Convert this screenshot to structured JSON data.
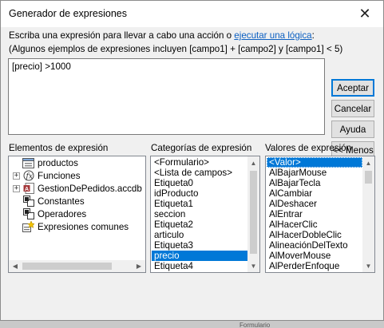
{
  "dialog": {
    "title": "Generador de expresiones",
    "close_label": "✕",
    "instruction_prefix": "Escriba una expresión para llevar a cabo una acción o ",
    "instruction_link": "ejecutar una lógica",
    "instruction_suffix": ":",
    "hint": "(Algunos ejemplos de expresiones incluyen [campo1] + [campo2] y [campo1] < 5)",
    "expression": "[precio] >1000"
  },
  "buttons": {
    "accept": "Aceptar",
    "cancel": "Cancelar",
    "help": "Ayuda",
    "less": "<< Menos"
  },
  "sections": {
    "elements": "Elementos de expresión",
    "categories": "Categorías de expresión",
    "values": "Valores de expresión"
  },
  "tree": [
    {
      "label": "productos",
      "icon": "form-icon",
      "expander": ""
    },
    {
      "label": "Funciones",
      "icon": "function-icon",
      "expander": "+"
    },
    {
      "label": "GestionDePedidos.accdb",
      "icon": "access-db-icon",
      "expander": "+"
    },
    {
      "label": "Constantes",
      "icon": "constants-icon",
      "expander": ""
    },
    {
      "label": "Operadores",
      "icon": "operators-icon",
      "expander": ""
    },
    {
      "label": "Expresiones comunes",
      "icon": "common-expr-icon",
      "expander": ""
    }
  ],
  "categories": [
    "<Formulario>",
    "<Lista de campos>",
    "Etiqueta0",
    "idProducto",
    "Etiqueta1",
    "seccion",
    "Etiqueta2",
    "articulo",
    "Etiqueta3",
    "precio",
    "Etiqueta4"
  ],
  "categories_selected": "precio",
  "values": [
    "<Valor>",
    "AlBajarMouse",
    "AlBajarTecla",
    "AlCambiar",
    "AlDeshacer",
    "AlEntrar",
    "AlHacerClic",
    "AlHacerDobleClic",
    "AlineaciónDelTexto",
    "AlMoverMouse",
    "AlPerderEnfoque"
  ],
  "values_selected": "<Valor>",
  "background": {
    "text": "Formulario"
  },
  "colors": {
    "selection": "#0078d7",
    "link": "#0b5fc1",
    "default_border": "#0078d7"
  }
}
